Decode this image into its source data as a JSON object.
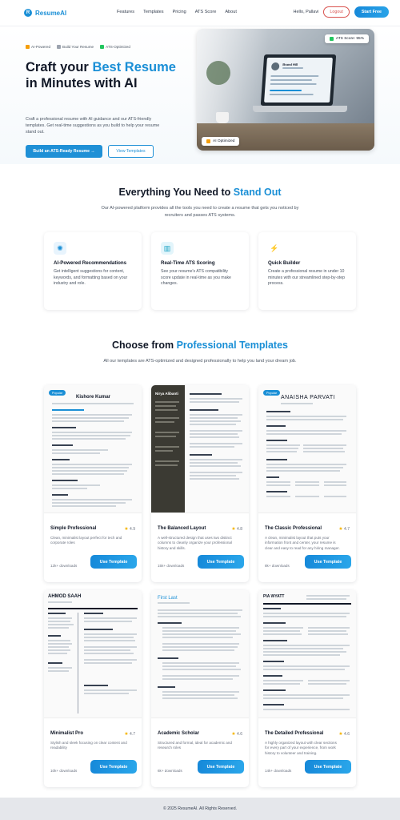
{
  "nav": {
    "logo_mark": "R",
    "logo": "ResumeAI",
    "links": [
      "Features",
      "Templates",
      "Pricing",
      "ATS Score",
      "About"
    ],
    "greeting": "Hello, Pallavi",
    "logout": "Logout",
    "start": "Start Free"
  },
  "hero": {
    "badges": [
      "AI-Powered",
      "Build Your Resume",
      "ATS-Optimized"
    ],
    "title_1": "Craft your ",
    "title_accent": "Best Resume",
    "title_2": " in Minutes with AI",
    "desc": "Craft a professional resume with AI guidance and our ATS-friendly templates. Get real-time suggestions as you build to help your resume stand out.",
    "primary_btn": "Build an ATS-Ready Resume →",
    "secondary_btn": "View Templates",
    "ats_chip": "ATS Score: 95%",
    "ai_chip": "AI Optimized",
    "screen_name": "Brand Hill"
  },
  "features": {
    "title_1": "Everything You Need to ",
    "title_accent": "Stand Out",
    "subtitle": "Our AI-powered platform provides all the tools you need to create a resume that gets you noticed by recruiters and passes ATS systems.",
    "cards": [
      {
        "icon": "brain-icon",
        "glyph": "✺",
        "title": "AI-Powered Recommendations",
        "desc": "Get intelligent suggestions for content, keywords, and formatting based on your industry and role."
      },
      {
        "icon": "chart-icon",
        "glyph": "▥",
        "title": "Real-Time ATS Scoring",
        "desc": "See your resume's ATS compatibility score update in real-time as you make changes."
      },
      {
        "icon": "lightning-icon",
        "glyph": "⚡",
        "title": "Quick Builder",
        "desc": "Create a professional resume in under 10 minutes with our streamlined step-by-step process."
      }
    ]
  },
  "templates": {
    "title_1": "Choose from ",
    "title_accent": "Professional Templates",
    "subtitle": "All our templates are ATS-optimized and designed professionally to help you land your dream job.",
    "popular_label": "Popular",
    "button": "Use Template",
    "items": [
      {
        "name": "Simple Professional",
        "rating": "4.9",
        "desc": "Clean, minimalist layout perfect for tech and corporate roles",
        "downloads": "12k+ downloads",
        "preview_name": "Kishore Kumar"
      },
      {
        "name": "The Balanced Layout",
        "rating": "4.8",
        "desc": "A well-structured design that uses two distinct columns to cleanly organize your professional history and skills.",
        "downloads": "15k+ downloads",
        "preview_name": "Nirya Alibanti"
      },
      {
        "name": "The Classic Professional",
        "rating": "4.7",
        "desc": "A clean, minimalist layout that puts your information front and center, your resume is clear and easy to read for any hiring manager.",
        "downloads": "8k+ downloads",
        "preview_name": "ANAISHA PARVATI"
      },
      {
        "name": "Minimalist Pro",
        "rating": "4.7",
        "desc": "Stylish and sleek focusing on clear content and readability",
        "downloads": "10k+ downloads",
        "preview_name": "AHMOD SAAH"
      },
      {
        "name": "Academic Scholar",
        "rating": "4.6",
        "desc": "Structured and formal, ideal for academic and research roles",
        "downloads": "6k+ downloads",
        "preview_name": "First Last"
      },
      {
        "name": "The Detailed Professional",
        "rating": "4.6",
        "desc": "A highly organized layout with clear sections for every part of your experience, from work history to volunteer and training.",
        "downloads": "14k+ downloads",
        "preview_name": "PIA WYATT"
      }
    ]
  },
  "footer": "© 2025 ResumeAI. All Rights Reserved.",
  "colors": {
    "accent": "#1a8fd6",
    "logout": "#d9534f",
    "star": "#f5b301"
  }
}
